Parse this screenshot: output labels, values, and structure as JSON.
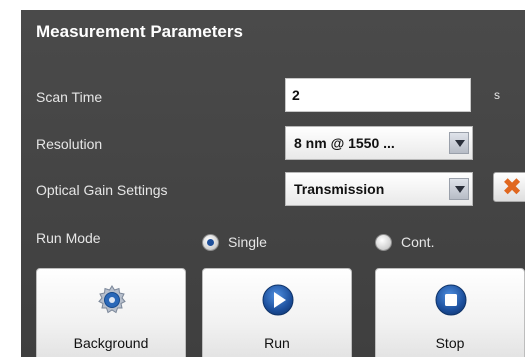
{
  "panel": {
    "title": "Measurement Parameters",
    "scan_time": {
      "label": "Scan Time",
      "value": "2",
      "unit": "s"
    },
    "resolution": {
      "label": "Resolution",
      "selected": "8 nm @ 1550 ..."
    },
    "optical_gain": {
      "label": "Optical Gain Settings",
      "selected": "Transmission"
    },
    "run_mode": {
      "label": "Run Mode",
      "options": [
        {
          "label": "Single",
          "checked": true
        },
        {
          "label": "Cont.",
          "checked": false
        }
      ]
    },
    "buttons": {
      "background": "Background",
      "run": "Run",
      "stop": "Stop"
    },
    "icons": {
      "background": "gear-icon",
      "run": "play-icon",
      "stop": "stop-icon",
      "clear": "x-icon"
    },
    "colors": {
      "panel_bg": "#454545",
      "accent_blue": "#1f4f9a",
      "clear_orange": "#e0671f"
    }
  }
}
